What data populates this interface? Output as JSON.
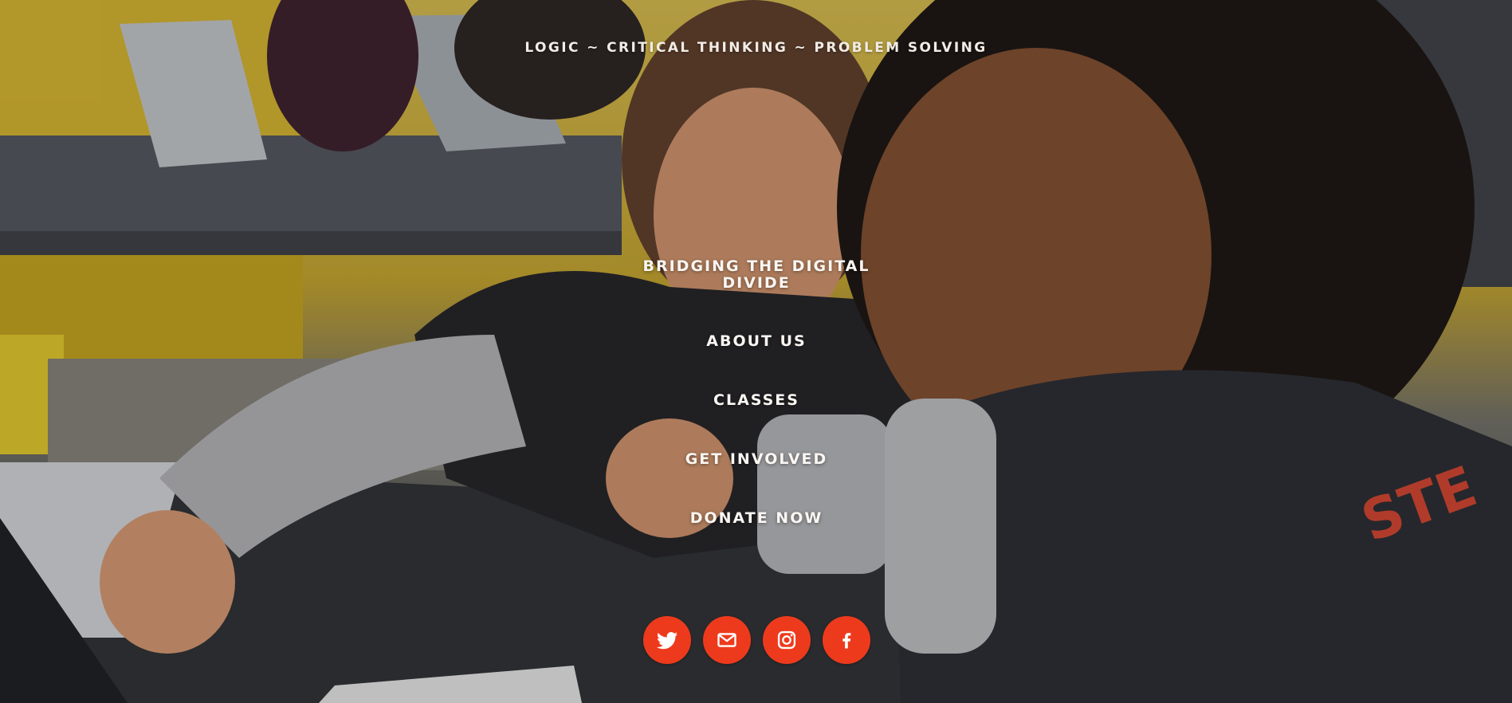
{
  "tagline": "LOGIC ~ CRITICAL THINKING ~ PROBLEM SOLVING",
  "nav": {
    "bridging_line1": "BRIDGING THE DIGITAL",
    "bridging_line2": "DIVIDE",
    "about": "ABOUT US",
    "classes": "CLASSES",
    "get_involved": "GET INVOLVED",
    "donate": "DONATE NOW"
  },
  "social": [
    {
      "icon": "twitter-icon"
    },
    {
      "icon": "email-icon"
    },
    {
      "icon": "instagram-icon"
    },
    {
      "icon": "facebook-icon"
    }
  ],
  "colors": {
    "accent": "#ee3a1c",
    "text": "#fbf6f2"
  }
}
